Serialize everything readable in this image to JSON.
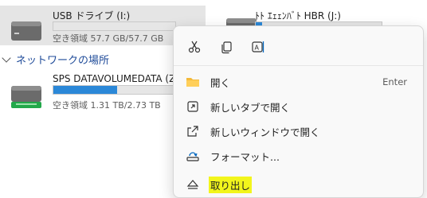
{
  "drives": [
    {
      "name": "USB ドライブ (I:)",
      "space": "空き領域 57.7 GB/57.7 GB",
      "used_fraction": 0.0,
      "selected": true
    },
    {
      "name": "ﾄﾄ ｴｪｪﾝﾊﾞﾄ HBR (J:)",
      "space": "",
      "used_fraction": 0.05,
      "selected": false
    },
    {
      "name": "SPS DATAVOLUMEDATA (Z:)",
      "space": "空き領域 1.31 TB/2.73 TB",
      "used_fraction": 0.52,
      "selected": false
    }
  ],
  "network_section": {
    "label": "ネットワークの場所"
  },
  "context_menu": {
    "toolbar": [
      {
        "icon": "cut-icon",
        "label": "切り取り"
      },
      {
        "icon": "copy-icon",
        "label": "コピー"
      },
      {
        "icon": "rename-icon",
        "label": "名前の変更"
      }
    ],
    "items": [
      {
        "label": "開く",
        "shortcut": "Enter",
        "icon": "folder-icon"
      },
      {
        "label": "新しいタブで開く",
        "shortcut": "",
        "icon": "open-tab-icon"
      },
      {
        "label": "新しいウィンドウで開く",
        "shortcut": "",
        "icon": "open-window-icon"
      },
      {
        "label": "フォーマット...",
        "shortcut": "",
        "icon": "format-icon"
      },
      {
        "label": "取り出し",
        "shortcut": "",
        "icon": "eject-icon",
        "highlighted": true
      }
    ]
  },
  "colors": {
    "bar_fill": "#2b88d8",
    "selected_bg": "#e5e5e5",
    "highlight": "#f2f51c",
    "link": "#1f4b99"
  }
}
